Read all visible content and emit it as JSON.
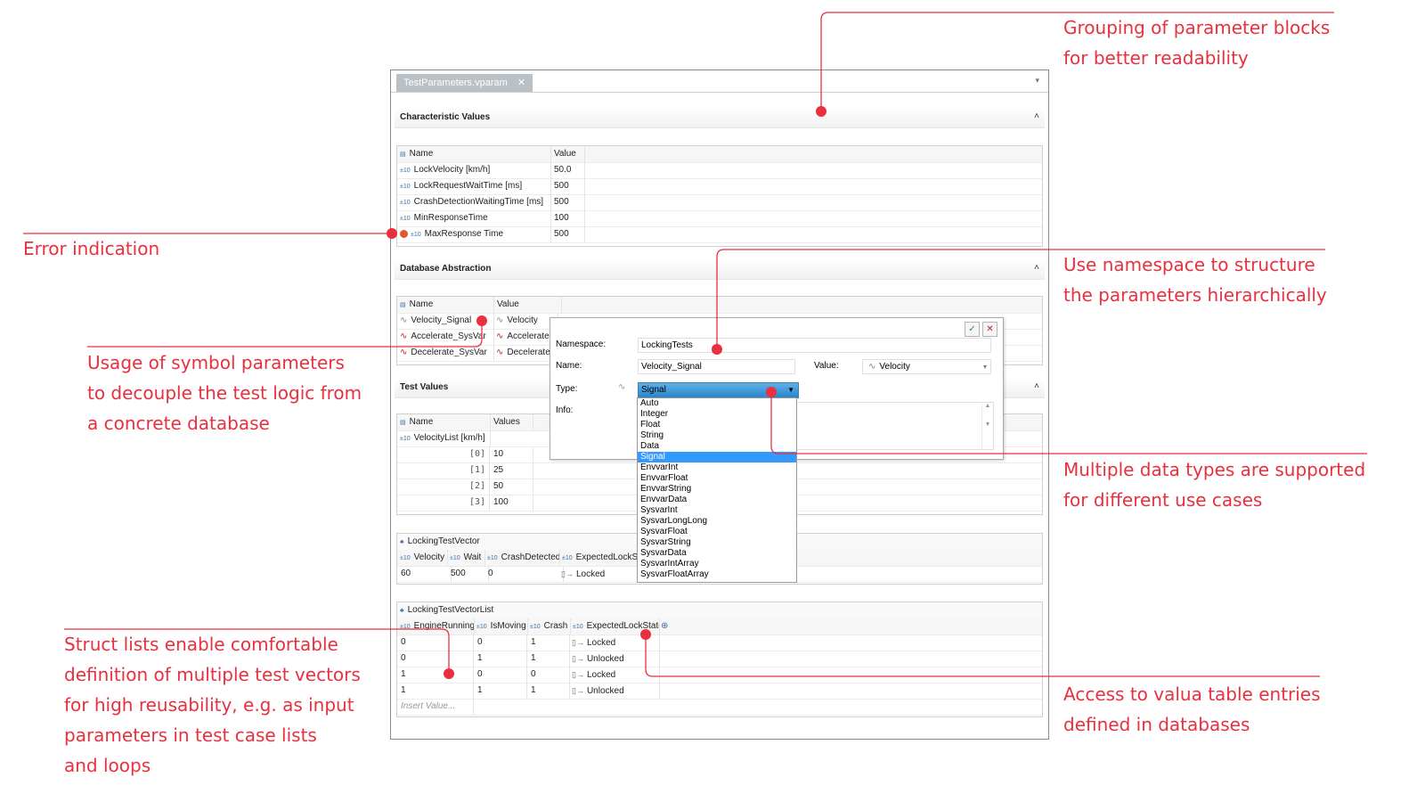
{
  "window": {
    "tab_title": "TestParameters.vparam",
    "tab_close": "✕",
    "tab_menu": "▾"
  },
  "annotations": {
    "grouping": [
      "Grouping of parameter blocks",
      "for better readability"
    ],
    "error": [
      "Error indication"
    ],
    "namespace": [
      "Use namespace to structure",
      "the parameters hierarchically"
    ],
    "symbol": [
      "Usage of symbol parameters",
      "to decouple the test logic from",
      "a concrete database"
    ],
    "types": [
      "Multiple data types are supported",
      "for different use cases"
    ],
    "struct": [
      "Struct lists enable comfortable",
      "definition of multiple test vectors",
      "for high reusability, e.g. as input",
      "parameters in test case lists",
      "and loops"
    ],
    "valuetable": [
      "Access to valua table entries",
      "defined in databases"
    ]
  },
  "characteristic": {
    "title": "Characteristic Values",
    "collapse": "˄",
    "headers": {
      "name": "Name",
      "value": "Value"
    },
    "rows": [
      {
        "name": "LockVelocity [km/h]",
        "value": "50.0",
        "error": false
      },
      {
        "name": "LockRequestWaitTime [ms]",
        "value": "500",
        "error": false
      },
      {
        "name": "CrashDetectionWaitingTime [ms]",
        "value": "500",
        "error": false
      },
      {
        "name": "MinResponseTime",
        "value": "100",
        "error": false
      },
      {
        "name": "MaxResponse Time",
        "value": "500",
        "error": true
      }
    ]
  },
  "database": {
    "title": "Database Abstraction",
    "collapse": "˄",
    "headers": {
      "name": "Name",
      "value": "Value"
    },
    "rows": [
      {
        "name": "Velocity_Signal",
        "value": "Velocity"
      },
      {
        "name": "Accelerate_SysVar",
        "value": "Accelerate"
      },
      {
        "name": "Decelerate_SysVar",
        "value": "Decelerate"
      }
    ]
  },
  "testvalues": {
    "title": "Test Values",
    "collapse": "˄",
    "headers": {
      "name": "Name",
      "values": "Values"
    },
    "list_name": "VelocityList [km/h]",
    "items": [
      {
        "idx": "[0]",
        "val": "10"
      },
      {
        "idx": "[1]",
        "val": "25"
      },
      {
        "idx": "[2]",
        "val": "50"
      },
      {
        "idx": "[3]",
        "val": "100"
      }
    ]
  },
  "vector": {
    "title": "LockingTestVector",
    "headers": [
      "Velocity",
      "Wait",
      "CrashDetected",
      "ExpectedLockSta"
    ],
    "row": [
      "60",
      "500",
      "0",
      "Locked"
    ]
  },
  "vectorlist": {
    "title": "LockingTestVectorList",
    "headers": [
      "EngineRunning",
      "IsMoving",
      "Crash",
      "ExpectedLockState"
    ],
    "add": "⊕",
    "rows": [
      [
        "0",
        "0",
        "1",
        "Locked"
      ],
      [
        "0",
        "1",
        "1",
        "Unlocked"
      ],
      [
        "1",
        "0",
        "0",
        "Locked"
      ],
      [
        "1",
        "1",
        "1",
        "Unlocked"
      ]
    ],
    "insert_placeholder": "Insert Value..."
  },
  "dialog": {
    "ok": "✓",
    "cancel": "✕",
    "namespace_label": "Namespace:",
    "namespace_value": "LockingTests",
    "name_label": "Name:",
    "name_value": "Velocity_Signal",
    "value_label": "Value:",
    "value_value": "Velocity",
    "type_label": "Type:",
    "type_value": "Signal",
    "info_label": "Info:",
    "type_options": [
      "Auto",
      "Integer",
      "Float",
      "String",
      "Data",
      "Signal",
      "EnvvarInt",
      "EnvvarFloat",
      "EnvvarString",
      "EnvvarData",
      "SysvarInt",
      "SysvarLongLong",
      "SysvarFloat",
      "SysvarString",
      "SysvarData",
      "SysvarIntArray",
      "SysvarFloatArray"
    ],
    "selected_option": "Signal"
  },
  "colors": {
    "accent": "#e8303f",
    "selection": "#3399ff"
  }
}
